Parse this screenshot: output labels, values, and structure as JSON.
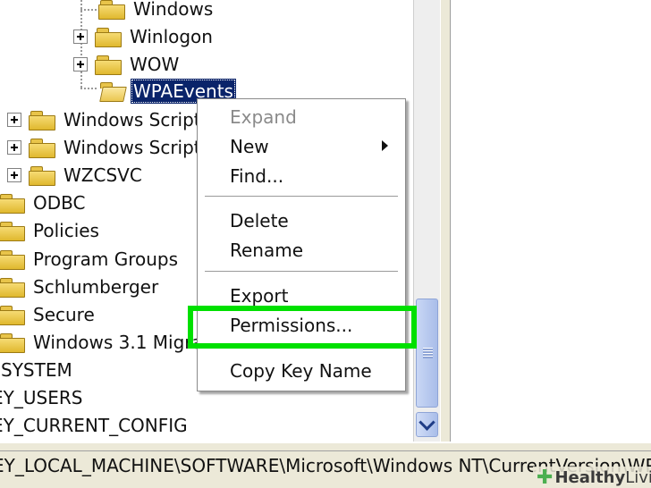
{
  "tree": {
    "items": [
      {
        "label": "Windows"
      },
      {
        "label": "Winlogon"
      },
      {
        "label": "WOW"
      },
      {
        "label": "WPAEvents"
      },
      {
        "label": "Windows Script"
      },
      {
        "label": "Windows Script"
      },
      {
        "label": "WZCSVC"
      },
      {
        "label": "ODBC"
      },
      {
        "label": "Policies"
      },
      {
        "label": "Program Groups"
      },
      {
        "label": "Schlumberger"
      },
      {
        "label": "Secure"
      },
      {
        "label": "Windows 3.1 Migra"
      },
      {
        "label": "SYSTEM"
      },
      {
        "label": "EY_USERS"
      },
      {
        "label": "EY_CURRENT_CONFIG"
      }
    ]
  },
  "context_menu": {
    "items": [
      {
        "label": "Expand",
        "state": "disabled"
      },
      {
        "label": "New"
      },
      {
        "label": "Find..."
      },
      {
        "label": "Delete"
      },
      {
        "label": "Rename"
      },
      {
        "label": "Export"
      },
      {
        "label": "Permissions..."
      },
      {
        "label": "Copy Key Name"
      }
    ],
    "highlighted_item": "Permissions...",
    "highlight_color": "#00e000"
  },
  "status_bar": {
    "path": "EY_LOCAL_MACHINE\\SOFTWARE\\Microsoft\\Windows NT\\CurrentVersion\\WPA"
  },
  "watermark": {
    "brand": "Healthy",
    "brand_light": "Living"
  },
  "colors": {
    "selection": "#0a246a",
    "highlight_box": "#00e000",
    "folder": "#e8c44a"
  },
  "icons": {
    "folder": "folder-icon",
    "expand": "plus-box-icon",
    "scroll_down": "chevron-down-icon",
    "submenu": "triangle-right-icon"
  }
}
